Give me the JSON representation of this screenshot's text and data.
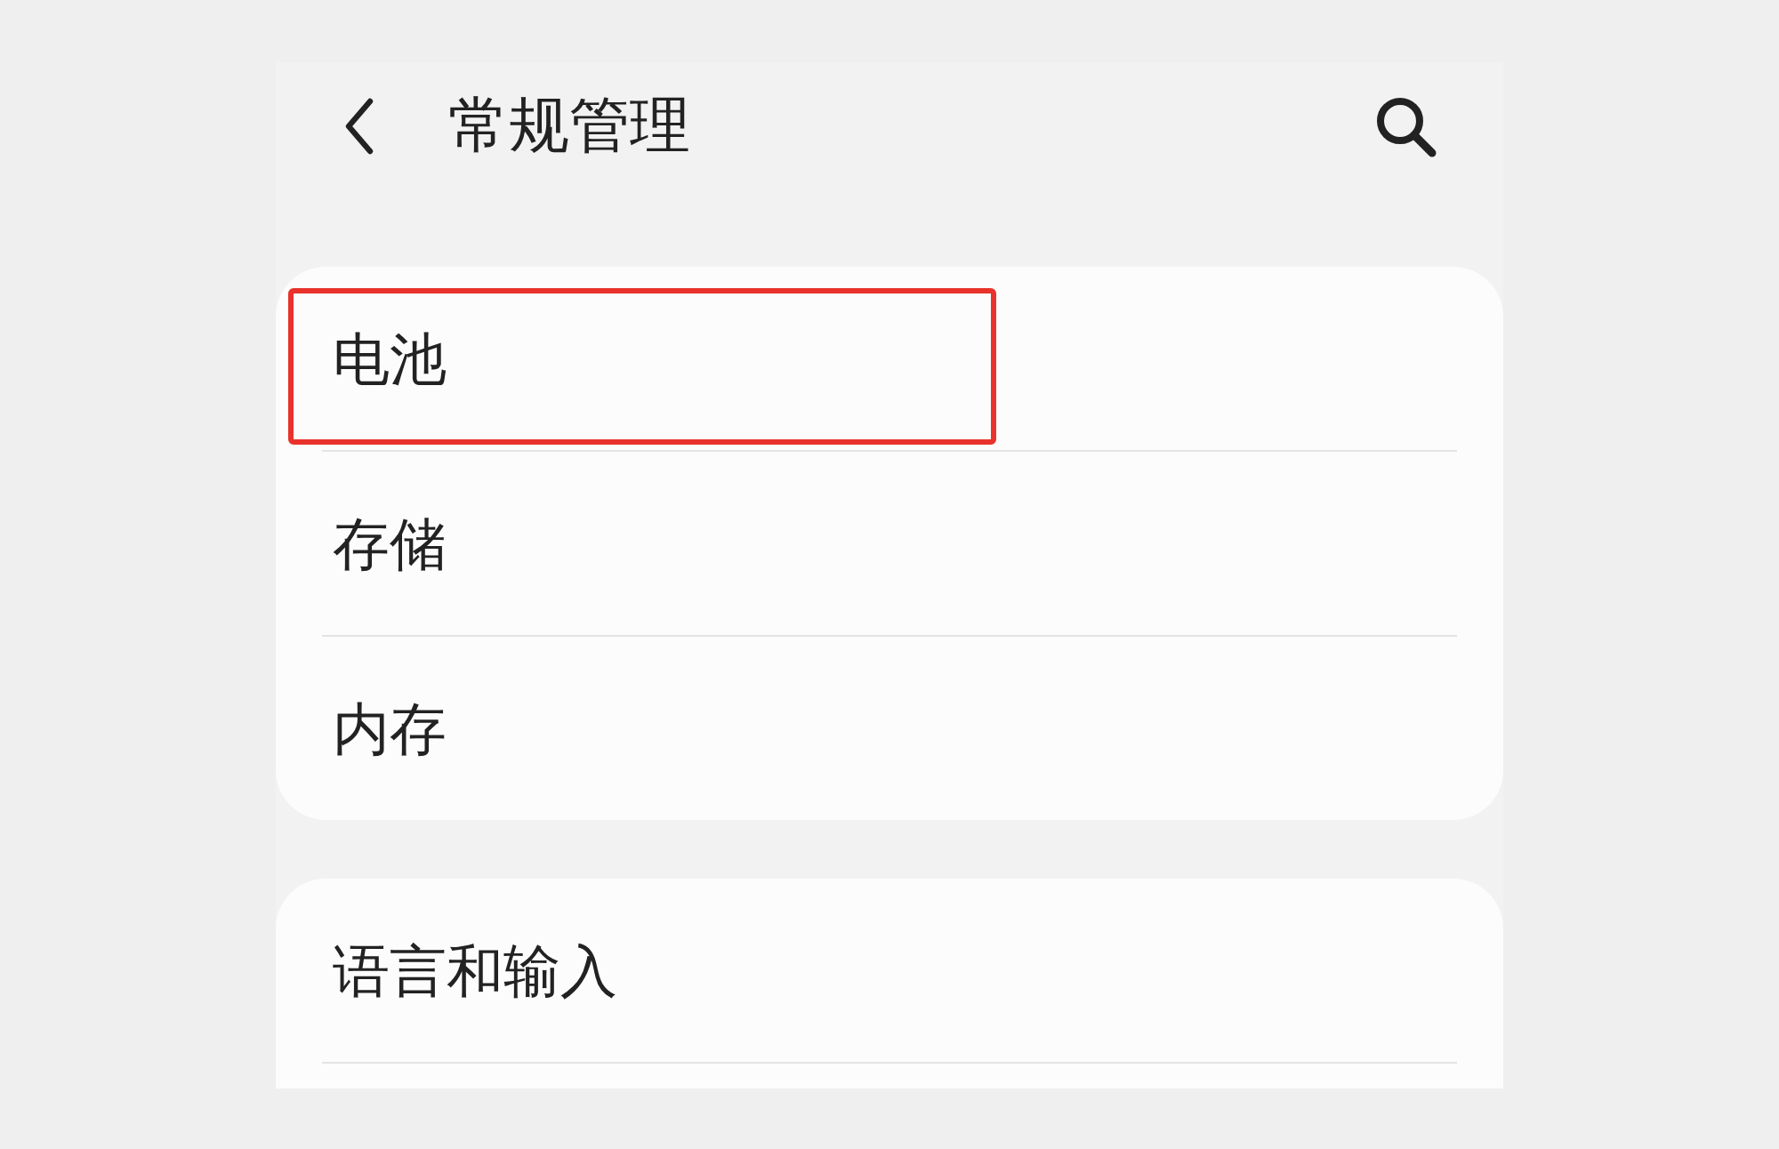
{
  "header": {
    "title": "常规管理"
  },
  "sections": [
    {
      "cut_off": false,
      "items": [
        {
          "label": "电池",
          "highlighted": true
        },
        {
          "label": "存储",
          "highlighted": false
        },
        {
          "label": "内存",
          "highlighted": false
        }
      ]
    },
    {
      "cut_off": true,
      "items": [
        {
          "label": "语言和输入",
          "highlighted": false
        }
      ]
    }
  ]
}
